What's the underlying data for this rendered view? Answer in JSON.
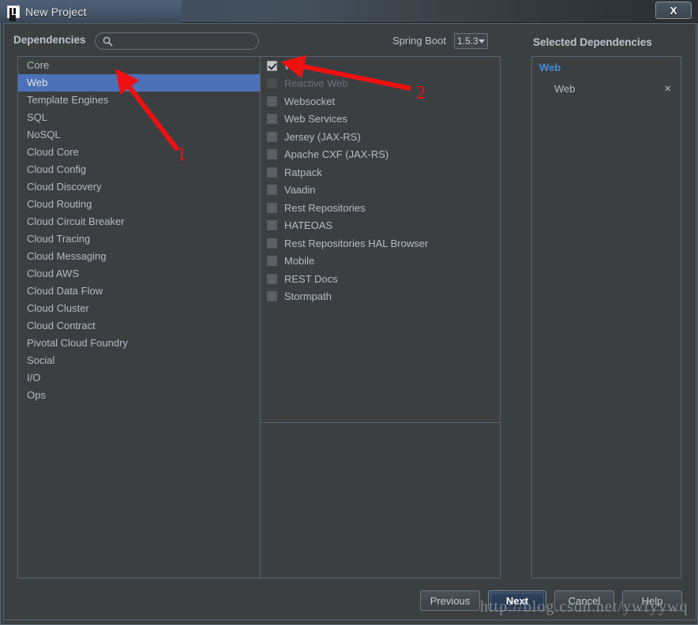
{
  "window": {
    "title": "New Project",
    "app_icon": "intellij-idea-icon",
    "close_label": "X"
  },
  "toolbar": {
    "dependencies_label": "Dependencies",
    "search_placeholder": "",
    "search_value": "",
    "search_icon": "search-icon",
    "spring_boot_label": "Spring Boot",
    "spring_boot_version": "1.5.3",
    "spring_boot_options": [
      "1.5.3"
    ]
  },
  "categories": {
    "selected": "Web",
    "items": [
      {
        "label": "Core",
        "selected": false
      },
      {
        "label": "Web",
        "selected": true
      },
      {
        "label": "Template Engines",
        "selected": false
      },
      {
        "label": "SQL",
        "selected": false
      },
      {
        "label": "NoSQL",
        "selected": false
      },
      {
        "label": "Cloud Core",
        "selected": false
      },
      {
        "label": "Cloud Config",
        "selected": false
      },
      {
        "label": "Cloud Discovery",
        "selected": false
      },
      {
        "label": "Cloud Routing",
        "selected": false
      },
      {
        "label": "Cloud Circuit Breaker",
        "selected": false
      },
      {
        "label": "Cloud Tracing",
        "selected": false
      },
      {
        "label": "Cloud Messaging",
        "selected": false
      },
      {
        "label": "Cloud AWS",
        "selected": false
      },
      {
        "label": "Cloud Data Flow",
        "selected": false
      },
      {
        "label": "Cloud Cluster",
        "selected": false
      },
      {
        "label": "Cloud Contract",
        "selected": false
      },
      {
        "label": "Pivotal Cloud Foundry",
        "selected": false
      },
      {
        "label": "Social",
        "selected": false
      },
      {
        "label": "I/O",
        "selected": false
      },
      {
        "label": "Ops",
        "selected": false
      }
    ]
  },
  "dependencies": {
    "items": [
      {
        "label": "Web",
        "checked": true,
        "disabled": false
      },
      {
        "label": "Reactive Web",
        "checked": false,
        "disabled": true
      },
      {
        "label": "Websocket",
        "checked": false,
        "disabled": false
      },
      {
        "label": "Web Services",
        "checked": false,
        "disabled": false
      },
      {
        "label": "Jersey (JAX-RS)",
        "checked": false,
        "disabled": false
      },
      {
        "label": "Apache CXF (JAX-RS)",
        "checked": false,
        "disabled": false
      },
      {
        "label": "Ratpack",
        "checked": false,
        "disabled": false
      },
      {
        "label": "Vaadin",
        "checked": false,
        "disabled": false
      },
      {
        "label": "Rest Repositories",
        "checked": false,
        "disabled": false
      },
      {
        "label": "HATEOAS",
        "checked": false,
        "disabled": false
      },
      {
        "label": "Rest Repositories HAL Browser",
        "checked": false,
        "disabled": false
      },
      {
        "label": "Mobile",
        "checked": false,
        "disabled": false
      },
      {
        "label": "REST Docs",
        "checked": false,
        "disabled": false
      },
      {
        "label": "Stormpath",
        "checked": false,
        "disabled": false
      }
    ]
  },
  "selected_dependencies": {
    "heading": "Selected Dependencies",
    "group_title": "Web",
    "entry_label": "Web",
    "remove_icon": "close-icon",
    "remove_glyph": "×"
  },
  "buttons": {
    "previous": "Previous",
    "next": "Next",
    "cancel": "Cancel",
    "help": "Help"
  },
  "annotations": {
    "marker_1": "1",
    "marker_2": "2",
    "color": "#ee1111"
  },
  "watermark": {
    "text": "http://blog.csdn.net/ywfyywq"
  },
  "colors": {
    "background": "#3c3f41",
    "selection_blue": "#4d71b8",
    "accent_blue": "#3f8ae0",
    "text": "#b6bcc3",
    "border": "#5a6570"
  }
}
